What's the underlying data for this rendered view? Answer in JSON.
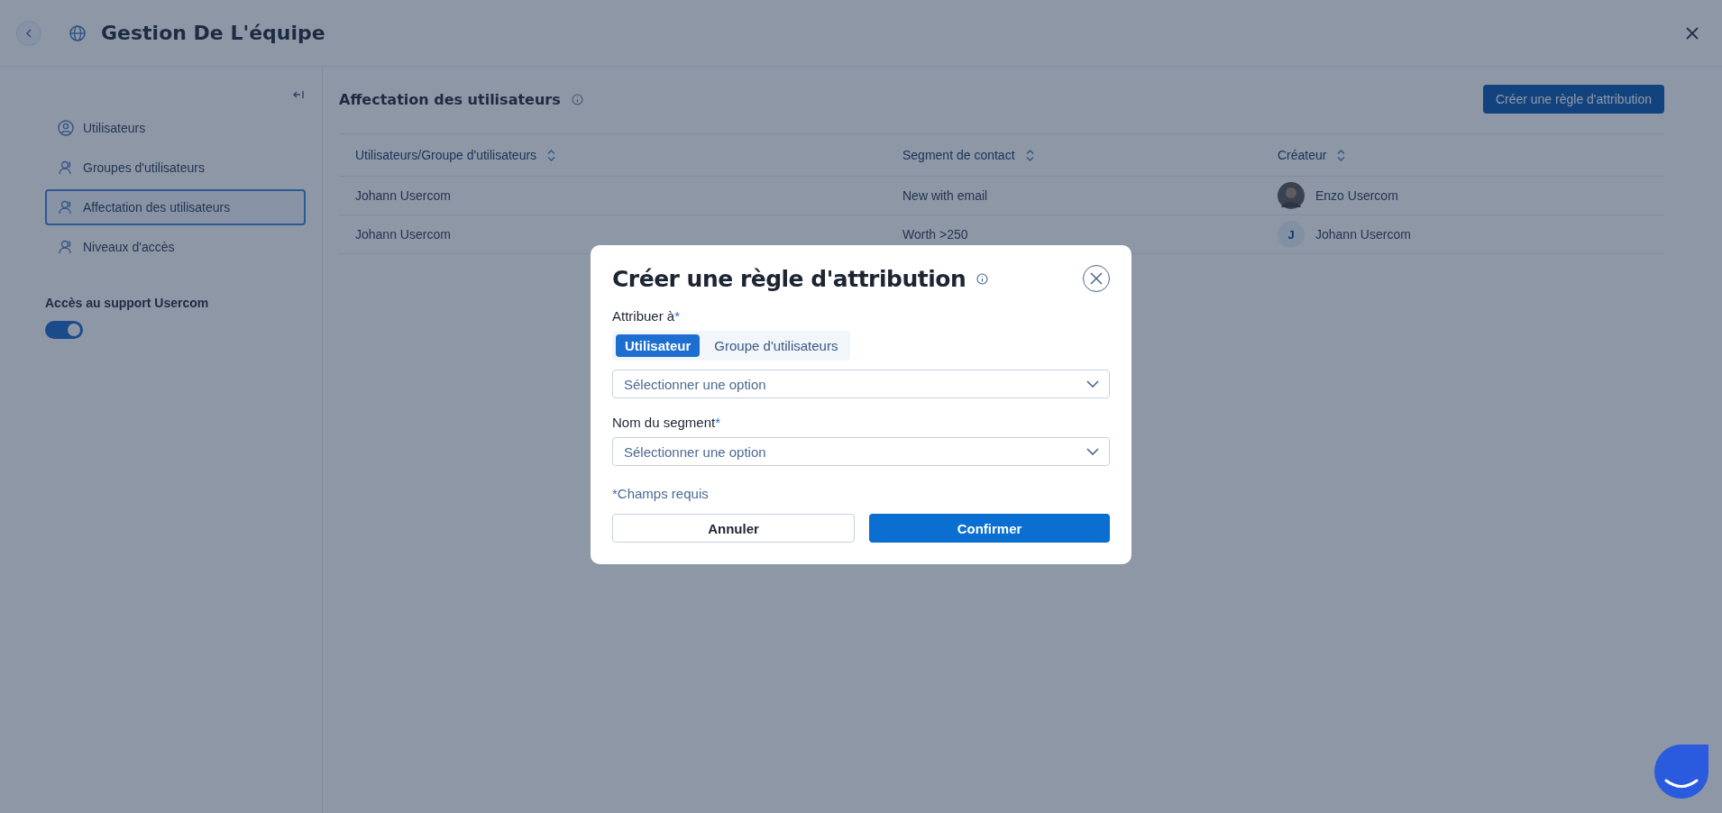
{
  "header": {
    "title": "Gestion De L'équipe"
  },
  "sidebar": {
    "items": [
      {
        "label": "Utilisateurs",
        "kind": "circle-user",
        "selected": false
      },
      {
        "label": "Groupes d'utilisateurs",
        "kind": "user",
        "selected": false
      },
      {
        "label": "Affectation des utilisateurs",
        "kind": "user",
        "selected": true
      },
      {
        "label": "Niveaux d'accès",
        "kind": "user",
        "selected": false
      }
    ],
    "support": {
      "label": "Accès au support Usercom",
      "on": true
    }
  },
  "main": {
    "title": "Affectation des utilisateurs",
    "create_button": "Créer une règle d'attribution",
    "table": {
      "columns": [
        "Utilisateurs/Groupe d'utilisateurs",
        "Segment de contact",
        "Créateur"
      ],
      "rows": [
        {
          "user": "Johann Usercom",
          "segment": "New with email",
          "creator": "Enzo Usercom"
        },
        {
          "user": "Johann Usercom",
          "segment": "Worth >250",
          "creator": "Johann Usercom",
          "initial": "J"
        }
      ]
    }
  },
  "modal": {
    "title": "Créer une règle d'attribution",
    "assign_label": "Attribuer à",
    "required_mark": "*",
    "tabs": [
      {
        "label": "Utilisateur",
        "selected": true
      },
      {
        "label": "Groupe d'utilisateurs",
        "selected": false
      }
    ],
    "assign_select": {
      "placeholder": "Sélectionner une option"
    },
    "segment_label": "Nom du segment",
    "segment_select": {
      "placeholder": "Sélectionner une option"
    },
    "required_note": "*Champs requis",
    "cancel": "Annuler",
    "confirm": "Confirmer"
  }
}
